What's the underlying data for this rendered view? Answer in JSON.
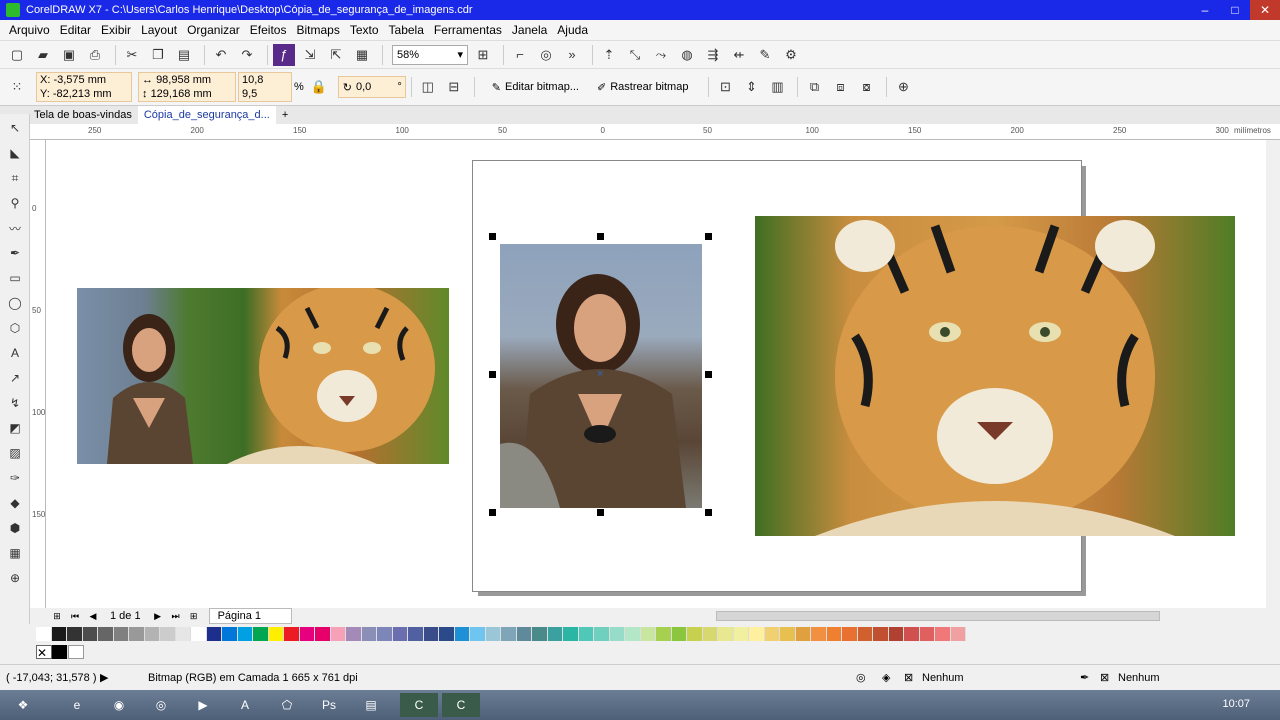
{
  "window": {
    "title": "CorelDRAW X7 - C:\\Users\\Carlos Henrique\\Desktop\\Cópia_de_segurança_de_imagens.cdr",
    "buttons": [
      "–",
      "□",
      "✕"
    ]
  },
  "menu": [
    "Arquivo",
    "Editar",
    "Exibir",
    "Layout",
    "Organizar",
    "Efeitos",
    "Bitmaps",
    "Texto",
    "Tabela",
    "Ferramentas",
    "Janela",
    "Ajuda"
  ],
  "toolbar": {
    "zoom": "58%"
  },
  "propbar": {
    "x": "X: -3,575 mm",
    "y": "Y: -82,213 mm",
    "width": "98,958 mm",
    "height": "129,168 mm",
    "scale_w": "10,8",
    "scale_h": "9,5",
    "pct": "%",
    "rotation": "0,0",
    "degree": "°",
    "edit_bitmap": "Editar bitmap...",
    "trace_bitmap": "Rastrear bitmap"
  },
  "tabs": [
    "Tela de boas-vindas",
    "Cópia_de_segurança_d..."
  ],
  "ruler": {
    "h_labels": [
      "250",
      "200",
      "150",
      "100",
      "50",
      "0",
      "50",
      "100",
      "150",
      "200",
      "250",
      "300"
    ],
    "units": "milímetros",
    "v_labels": [
      "0",
      "50",
      "100",
      "150"
    ]
  },
  "pagenav": {
    "count": "1 de 1",
    "page": "Página 1"
  },
  "status": {
    "coords": "( -17,043; 31,578 )",
    "info": "Bitmap (RGB) em Camada 1 665 x 761 dpi",
    "fill": "Nenhum",
    "outline": "Nenhum"
  },
  "clock": "10:07",
  "palette": [
    "#ffffff",
    "#1a1a1a",
    "#333333",
    "#4d4d4d",
    "#666666",
    "#808080",
    "#999999",
    "#b3b3b3",
    "#cccccc",
    "#e6e6e6",
    "#ffffff",
    "#1d2e8c",
    "#0077d9",
    "#00a0e3",
    "#00a651",
    "#ffee00",
    "#ed1c24",
    "#e6007e",
    "#e5006a",
    "#f7a1b8",
    "#a48ab8",
    "#8b8fb8",
    "#7c86b8",
    "#6b6fb0",
    "#5060a0",
    "#3a4d8a",
    "#2a4a8a",
    "#1e90d6",
    "#6ec6f0",
    "#9bc6d8",
    "#7fa6b8",
    "#5f8a9c",
    "#4a8a8a",
    "#3aa0a0",
    "#2ab5a5",
    "#50c8b8",
    "#6fd0c0",
    "#96dcc8",
    "#b4e6c8",
    "#c8e6a0",
    "#a8d050",
    "#8cc63f",
    "#c8d050",
    "#d8d870",
    "#e8e890",
    "#f0f0a0",
    "#fff0a0",
    "#f0d070",
    "#e8c050",
    "#e0a040",
    "#f09040",
    "#f08030",
    "#e87030",
    "#d06030",
    "#c05030",
    "#b04030",
    "#d05050",
    "#e06060",
    "#f07878",
    "#f0a0a0"
  ]
}
